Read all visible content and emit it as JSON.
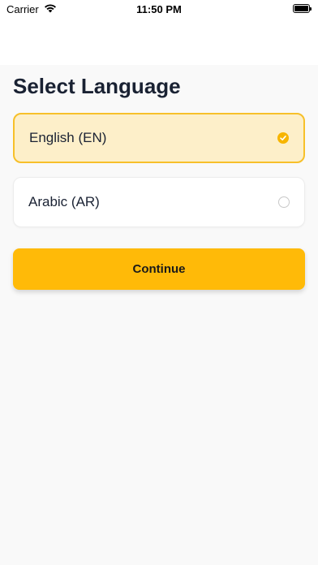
{
  "status_bar": {
    "carrier": "Carrier",
    "time": "11:50 PM",
    "icons": [
      "wifi-icon",
      "battery-icon"
    ]
  },
  "page": {
    "title": "Select Language"
  },
  "languages": [
    {
      "label": "English (EN)",
      "selected": true
    },
    {
      "label": "Arabic (AR)",
      "selected": false
    }
  ],
  "actions": {
    "continue_label": "Continue"
  },
  "colors": {
    "accent": "#ffba08",
    "selected_background": "#fdefc9",
    "selected_border": "#f7c02a",
    "page_background": "#f9f9f9",
    "text": "#1a2233"
  }
}
